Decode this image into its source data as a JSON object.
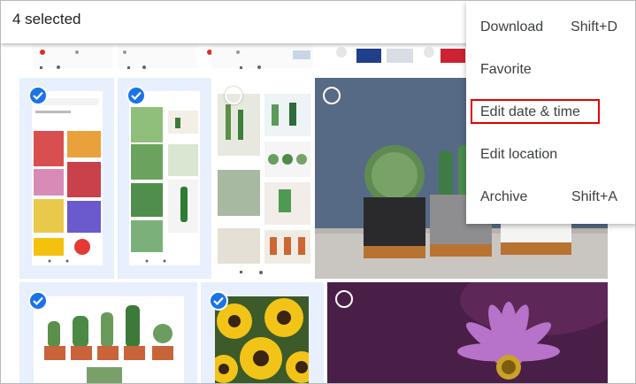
{
  "selection_bar": {
    "count_text": "4 selected"
  },
  "menu": {
    "items": [
      {
        "label": "Download",
        "shortcut": "Shift+D"
      },
      {
        "label": "Favorite",
        "shortcut": ""
      },
      {
        "label": "Edit date & time",
        "shortcut": ""
      },
      {
        "label": "Edit location",
        "shortcut": ""
      },
      {
        "label": "Archive",
        "shortcut": "Shift+A"
      }
    ],
    "highlighted_item": "Edit date & time"
  },
  "colors": {
    "selection_accent": "#1a73e8",
    "selected_tile_bg": "#e8f0fe",
    "annotation_box": "#e00000"
  },
  "photos": [
    {
      "name": "phone-screenshot-flowers",
      "selected": true
    },
    {
      "name": "phone-screenshot-cactus-1",
      "selected": true
    },
    {
      "name": "phone-screenshot-cactus-2",
      "selected": false
    },
    {
      "name": "cactus-pots-photo",
      "selected": false
    },
    {
      "name": "potted-cacti-photo",
      "selected": true
    },
    {
      "name": "sunflowers-photo",
      "selected": true
    },
    {
      "name": "purple-daisy-photo",
      "selected": false
    }
  ]
}
